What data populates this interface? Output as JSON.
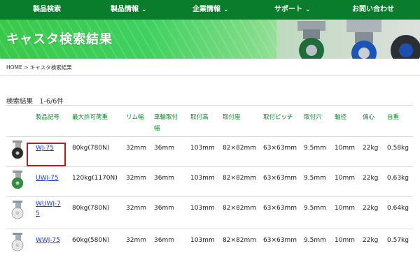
{
  "nav": {
    "items": [
      {
        "label": "製品検索",
        "has_chevron": false
      },
      {
        "label": "製品情報",
        "has_chevron": true
      },
      {
        "label": "企業情報",
        "has_chevron": true
      },
      {
        "label": "サポート",
        "has_chevron": true
      },
      {
        "label": "お問い合わせ",
        "has_chevron": false
      }
    ],
    "chevron": "⌄"
  },
  "banner": {
    "title": "キャスタ検索結果"
  },
  "breadcrumb": {
    "text": "HOME > キャスタ検索結果"
  },
  "results": {
    "label": "検索結果　1-6/6件"
  },
  "table": {
    "headers": [
      "製品記号",
      "最大許可荷重",
      "リム幅",
      "車輪取付\n幅",
      "取付高",
      "取付座",
      "取付ピッチ",
      "取付穴",
      "軸径",
      "偏心",
      "自重"
    ],
    "rows": [
      {
        "model": "WJ-75",
        "load": "80kg(780N)",
        "rim": "32mm",
        "mount_w": "36mm",
        "height": "103mm",
        "seat": "82×82mm",
        "pitch": "63×63mm",
        "hole": "9.5mm",
        "axle": "10mm",
        "offset": "22kg",
        "weight": "0.58kg",
        "wheel": "black"
      },
      {
        "model": "UWJ-75",
        "load": "120kg(1170N)",
        "rim": "32mm",
        "mount_w": "36mm",
        "height": "103mm",
        "seat": "82×82mm",
        "pitch": "63×63mm",
        "hole": "9.5mm",
        "axle": "10mm",
        "offset": "22kg",
        "weight": "0.63kg",
        "wheel": "green"
      },
      {
        "model": "WUWJ-75",
        "load": "80kg(780N)",
        "rim": "32mm",
        "mount_w": "36mm",
        "height": "103mm",
        "seat": "82×82mm",
        "pitch": "63×63mm",
        "hole": "9.5mm",
        "axle": "10mm",
        "offset": "22kg",
        "weight": "0.64kg",
        "wheel": "white"
      },
      {
        "model": "WWJ-75",
        "load": "60kg(580N)",
        "rim": "32mm",
        "mount_w": "36mm",
        "height": "103mm",
        "seat": "82×82mm",
        "pitch": "63×63mm",
        "hole": "9.5mm",
        "axle": "10mm",
        "offset": "22kg",
        "weight": "0.57kg",
        "wheel": "white"
      }
    ]
  },
  "colors": {
    "nav_bg": "#0a7d2c",
    "header_text": "#0a8a2a",
    "link": "#1a3fd0",
    "highlight": "#d0121b"
  }
}
